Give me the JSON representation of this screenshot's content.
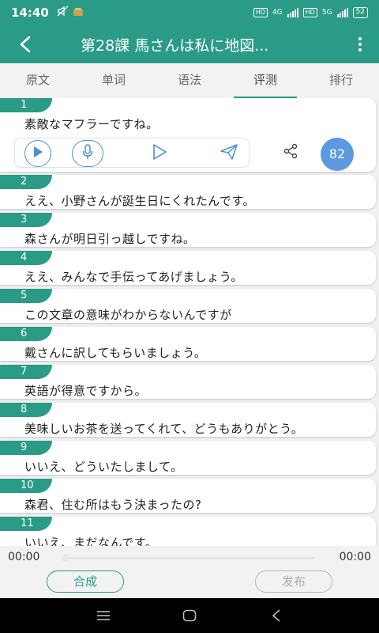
{
  "status_bar": {
    "time": "14:40",
    "network_labels": [
      "HD",
      "4G",
      "HD",
      "5G"
    ],
    "battery": "52"
  },
  "header": {
    "title": "第28課 馬さんは私に地図..."
  },
  "tabs": [
    {
      "label": "原文",
      "active": false
    },
    {
      "label": "单词",
      "active": false
    },
    {
      "label": "语法",
      "active": false
    },
    {
      "label": "评测",
      "active": true
    },
    {
      "label": "排行",
      "active": false
    }
  ],
  "sentences": [
    {
      "num": "1",
      "text": "素敵なマフラーですね。",
      "score": "82"
    },
    {
      "num": "2",
      "text": "ええ、小野さんが誕生日にくれたんです。"
    },
    {
      "num": "3",
      "text": "森さんが明日引っ越しですね。"
    },
    {
      "num": "4",
      "text": "ええ、みんなで手伝ってあげましょう。"
    },
    {
      "num": "5",
      "text": "この文章の意味がわからないんですが"
    },
    {
      "num": "6",
      "text": "戴さんに訳してもらいましょう。"
    },
    {
      "num": "7",
      "text": "英語が得意ですから。"
    },
    {
      "num": "8",
      "text": "美味しいお茶を送ってくれて、どうもありがとう。"
    },
    {
      "num": "9",
      "text": "いいえ、どういたしまして。"
    },
    {
      "num": "10",
      "text": "森君、住む所はもう決まったの?"
    },
    {
      "num": "11",
      "text": "いいえ、まだなんです。"
    }
  ],
  "player": {
    "current_time": "00:00",
    "total_time": "00:00",
    "progress": 0
  },
  "actions": {
    "synthesize_label": "合成",
    "publish_label": "发布"
  },
  "icons": {
    "status": [
      "mute-icon",
      "app-notification-icon",
      "signal-icon",
      "battery-icon"
    ],
    "header": [
      "back-arrow-icon",
      "more-vert-icon"
    ],
    "controls": [
      "play-circle-icon",
      "mic-icon",
      "play-outline-icon",
      "send-icon",
      "share-icon"
    ],
    "nav": [
      "recents-icon",
      "home-icon",
      "back-icon"
    ]
  },
  "colors": {
    "primary": "#2a9b86",
    "accent_blue": "#4a90d9",
    "score_bg": "#5b9ae0"
  }
}
